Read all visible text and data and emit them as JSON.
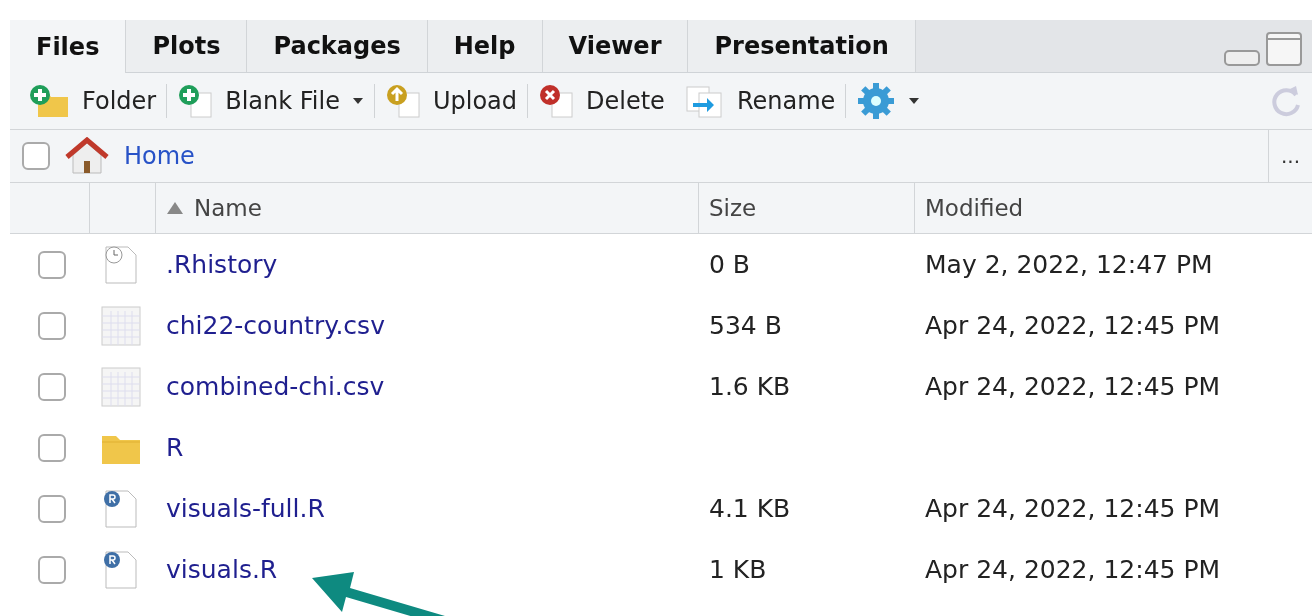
{
  "tabs": [
    {
      "label": "Files",
      "selected": true
    },
    {
      "label": "Plots",
      "selected": false
    },
    {
      "label": "Packages",
      "selected": false
    },
    {
      "label": "Help",
      "selected": false
    },
    {
      "label": "Viewer",
      "selected": false
    },
    {
      "label": "Presentation",
      "selected": false
    }
  ],
  "toolbar": [
    {
      "kind": "folder",
      "label": "Folder",
      "dropdown": false
    },
    {
      "kind": "blank",
      "label": "Blank File",
      "dropdown": true
    },
    {
      "kind": "upload",
      "label": "Upload",
      "dropdown": false
    },
    {
      "kind": "delete",
      "label": "Delete",
      "dropdown": false
    },
    {
      "kind": "rename",
      "label": "Rename",
      "dropdown": false
    },
    {
      "kind": "gear",
      "dropdown": true
    }
  ],
  "path": {
    "checked": false,
    "label": "Home",
    "more": "..."
  },
  "columns": [
    "Name",
    "Size",
    "Modified"
  ],
  "rows": [
    {
      "kind": "history",
      "name": ".Rhistory",
      "size": "0 B",
      "modified": "May 2, 2022, 12:47 PM",
      "checked": false
    },
    {
      "kind": "csv",
      "name": "chi22-country.csv",
      "size": "534 B",
      "modified": "Apr 24, 2022, 12:45 PM",
      "checked": false
    },
    {
      "kind": "csv",
      "name": "combined-chi.csv",
      "size": "1.6 KB",
      "modified": "Apr 24, 2022, 12:45 PM",
      "checked": false
    },
    {
      "kind": "folder",
      "name": "R",
      "checked": false
    },
    {
      "kind": "r",
      "name": "visuals-full.R",
      "size": "4.1 KB",
      "modified": "Apr 24, 2022, 12:45 PM",
      "checked": false
    },
    {
      "kind": "r",
      "name": "visuals.R",
      "size": "1 KB",
      "modified": "Apr 24, 2022, 12:45 PM",
      "checked": false
    }
  ]
}
